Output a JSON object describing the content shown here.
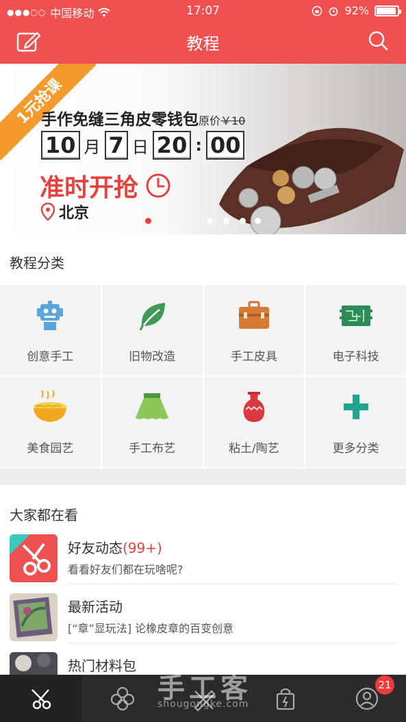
{
  "status_bar": {
    "signal": "●●●○○",
    "carrier": "中国移动",
    "time": "17:07",
    "battery": "92%"
  },
  "header": {
    "title": "教程",
    "edit_icon": "edit-icon",
    "search_icon": "search-icon"
  },
  "banner": {
    "ribbon": "1元抢课",
    "title": "手作免缝三角皮零钱包",
    "orig_label": "原价",
    "orig_price": "￥10",
    "month": "10",
    "month_unit": "月",
    "day": "7",
    "day_unit": "日",
    "hour": "20",
    "colon": ":",
    "minute": "00",
    "rush_text": "准时开抢",
    "location": "北京",
    "slide_count": 5,
    "active_slide": 0
  },
  "categories": {
    "title": "教程分类",
    "items": [
      {
        "label": "创意手工",
        "icon": "robot-icon"
      },
      {
        "label": "旧物改造",
        "icon": "leaf-icon"
      },
      {
        "label": "手工皮具",
        "icon": "briefcase-icon"
      },
      {
        "label": "电子科技",
        "icon": "circuit-board-icon"
      },
      {
        "label": "美食园艺",
        "icon": "noodle-bowl-icon"
      },
      {
        "label": "手工布艺",
        "icon": "skirt-icon"
      },
      {
        "label": "粘土/陶艺",
        "icon": "vase-icon"
      },
      {
        "label": "更多分类",
        "icon": "plus-icon"
      }
    ]
  },
  "feed": {
    "title": "大家都在看",
    "items": [
      {
        "title": "好友动态",
        "count": "(99+)",
        "subtitle": "看看好友们都在玩啥呢?"
      },
      {
        "title": "最新活动",
        "subtitle": "[“章”显玩法] 论橡皮章的百变创意"
      },
      {
        "title": "热门材料包",
        "subtitle": ""
      }
    ]
  },
  "tabbar": {
    "tabs": [
      "scissors-icon",
      "flower-icon",
      "pencil-ruler-icon",
      "shopping-bag-icon",
      "profile-icon"
    ],
    "badge": "21",
    "active": 0
  },
  "watermark": {
    "text": "手工客",
    "url": "shougongke.com"
  },
  "colors": {
    "brand_red": "#ef5050",
    "accent_red": "#e8403f",
    "ribbon_orange": "#f39a2b",
    "tabbar_bg": "#2b2b2b"
  }
}
